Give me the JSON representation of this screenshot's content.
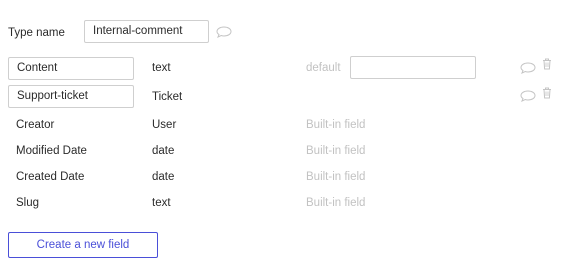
{
  "type_name": {
    "label": "Type name",
    "value": "Internal-comment",
    "comment_icon": "speech-bubble-icon"
  },
  "editable_fields": [
    {
      "name": "Content",
      "type": "text",
      "default_label": "default",
      "default_value": "",
      "comment_icon": "speech-bubble-icon",
      "delete_icon": "trash-icon"
    },
    {
      "name": "Support-ticket",
      "type": "Ticket",
      "comment_icon": "speech-bubble-icon",
      "delete_icon": "trash-icon"
    }
  ],
  "builtin_fields": [
    {
      "name": "Creator",
      "type": "User",
      "note": "Built-in field"
    },
    {
      "name": "Modified Date",
      "type": "date",
      "note": "Built-in field"
    },
    {
      "name": "Created Date",
      "type": "date",
      "note": "Built-in field"
    },
    {
      "name": "Slug",
      "type": "text",
      "note": "Built-in field"
    }
  ],
  "create_button": {
    "label": "Create a new field"
  },
  "colors": {
    "accent": "#4a4fd8",
    "muted_text": "#c2c2c2",
    "border": "#cfcfcf",
    "icon": "#c4c4c4"
  }
}
